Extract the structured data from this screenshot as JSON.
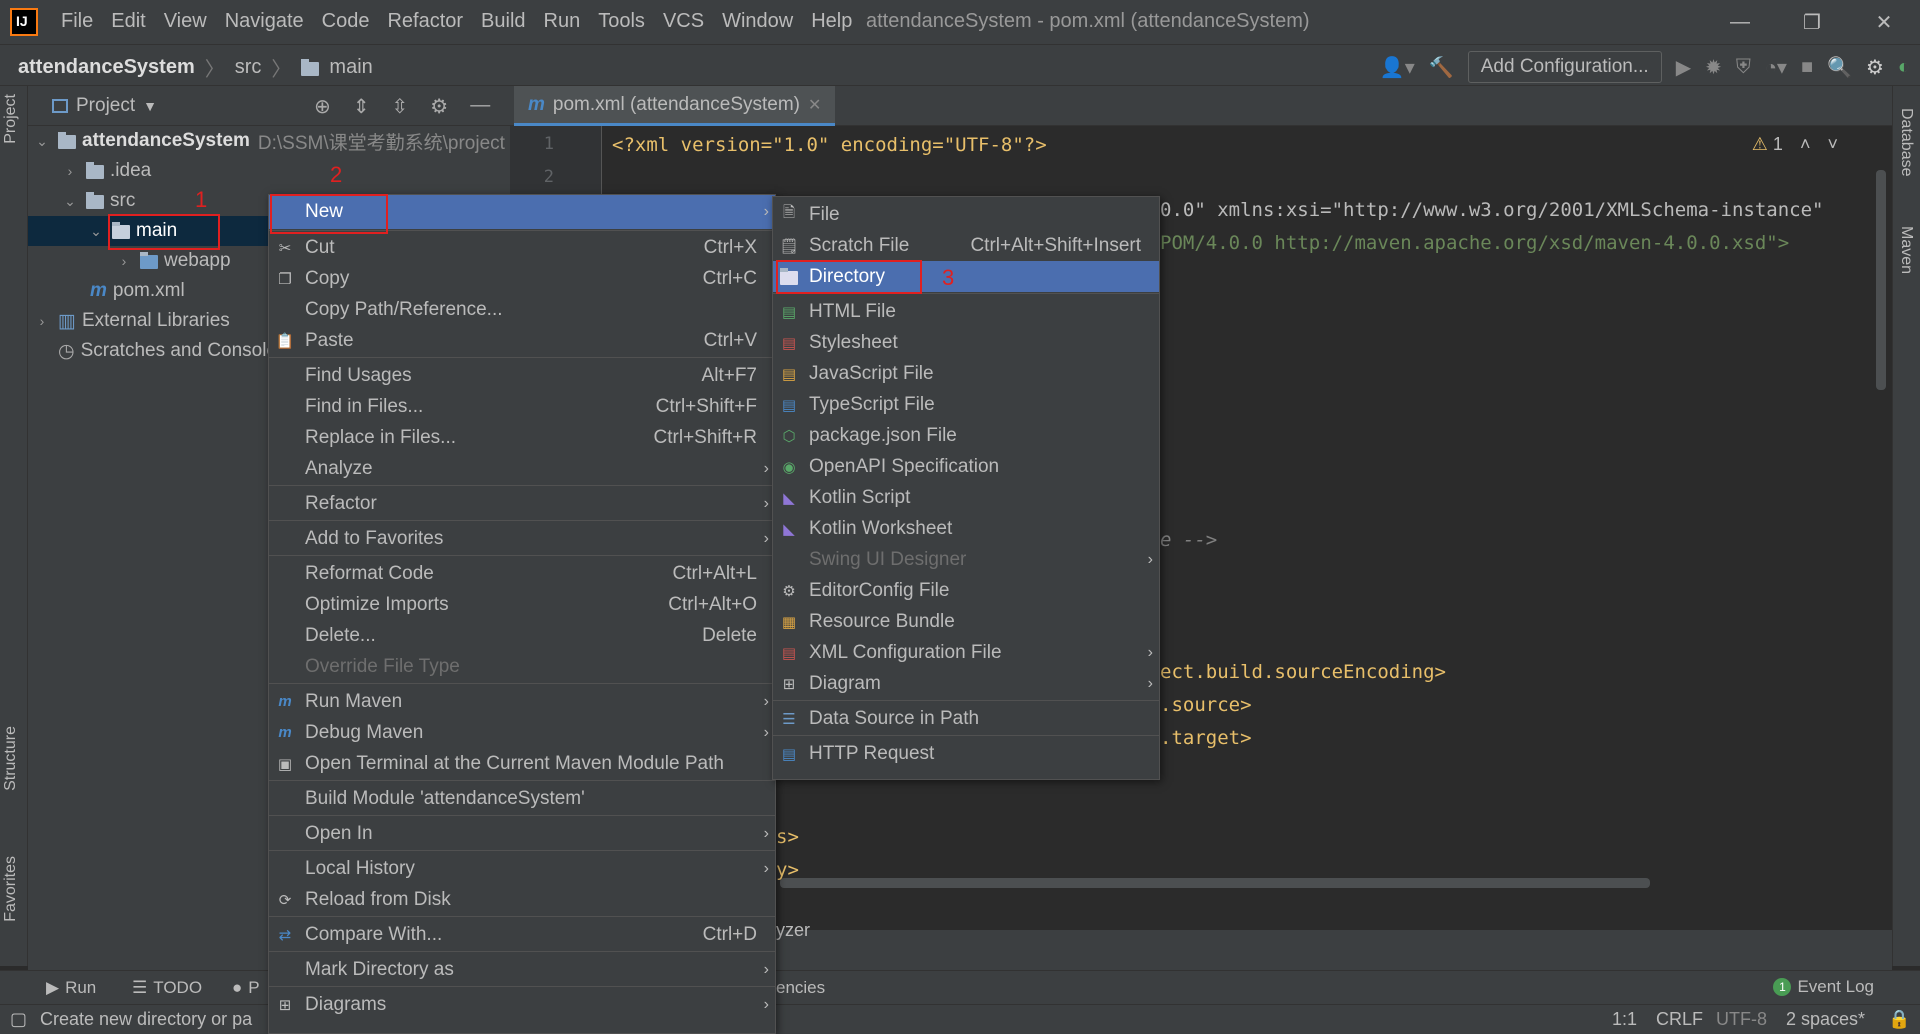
{
  "title_bar": {
    "menu": [
      "File",
      "Edit",
      "View",
      "Navigate",
      "Code",
      "Refactor",
      "Build",
      "Run",
      "Tools",
      "VCS",
      "Window",
      "Help"
    ],
    "window_title": "attendanceSystem - pom.xml (attendanceSystem)",
    "controls": [
      "—",
      "❐",
      "✕"
    ]
  },
  "nav_bar": {
    "breadcrumb": [
      "attendanceSystem",
      "src",
      "main"
    ],
    "add_config_label": "Add Configuration..."
  },
  "left_strip": {
    "project": "Project",
    "structure": "Structure",
    "favorites": "Favorites"
  },
  "right_strip": {
    "database": "Database",
    "maven": "Maven"
  },
  "project_panel": {
    "title": "Project",
    "tree": [
      {
        "label": "attendanceSystem",
        "path": "D:\\SSM\\课堂考勤系统\\project"
      },
      {
        "label": ".idea"
      },
      {
        "label": "src"
      },
      {
        "label": "main"
      },
      {
        "label": "webapp"
      },
      {
        "label": "pom.xml"
      },
      {
        "label": "External Libraries"
      },
      {
        "label": "Scratches and Console"
      }
    ]
  },
  "editor": {
    "tab_label": "pom.xml (attendanceSystem)",
    "line_numbers": [
      "1",
      "2"
    ],
    "warning_count": "1",
    "code": {
      "l1": "<?xml version=\"1.0\" encoding=\"UTF-8\"?>",
      "l3_tail": "0.0\" xmlns:xsi=\"http://www.w3.org/2001/XMLSchema-instance\"",
      "l4_tail": "POM/4.0.0 http://maven.apache.org/xsd/maven-4.0.0.xsd\">",
      "l15_tail": "e -->",
      "l19_tail": "ect.build.sourceEncoding>",
      "l20_tail": ".source>",
      "l21_tail": ".target>",
      "l25_tail": "s>",
      "l26_tail": "y>"
    }
  },
  "bottom_panel": {
    "tail1": "yzer",
    "tail2": "encies",
    "run": "Run",
    "todo": "TODO",
    "problems": "P",
    "event_log": "Event Log",
    "event_count": "1"
  },
  "status_bar": {
    "message": "Create new directory or pa",
    "position": "1:1",
    "line_sep": "CRLF",
    "encoding": "UTF-8",
    "indent": "2 spaces*"
  },
  "context_menu": {
    "items": [
      {
        "label": "New",
        "shortcut": "",
        "submenu": true
      },
      {
        "label": "Cut",
        "shortcut": "Ctrl+X"
      },
      {
        "label": "Copy",
        "shortcut": "Ctrl+C"
      },
      {
        "label": "Copy Path/Reference...",
        "shortcut": ""
      },
      {
        "label": "Paste",
        "shortcut": "Ctrl+V"
      },
      {
        "label": "Find Usages",
        "shortcut": "Alt+F7"
      },
      {
        "label": "Find in Files...",
        "shortcut": "Ctrl+Shift+F"
      },
      {
        "label": "Replace in Files...",
        "shortcut": "Ctrl+Shift+R"
      },
      {
        "label": "Analyze",
        "shortcut": "",
        "submenu": true
      },
      {
        "label": "Refactor",
        "shortcut": "",
        "submenu": true
      },
      {
        "label": "Add to Favorites",
        "shortcut": "",
        "submenu": true
      },
      {
        "label": "Reformat Code",
        "shortcut": "Ctrl+Alt+L"
      },
      {
        "label": "Optimize Imports",
        "shortcut": "Ctrl+Alt+O"
      },
      {
        "label": "Delete...",
        "shortcut": "Delete"
      },
      {
        "label": "Override File Type",
        "shortcut": ""
      },
      {
        "label": "Run Maven",
        "shortcut": "",
        "submenu": true
      },
      {
        "label": "Debug Maven",
        "shortcut": "",
        "submenu": true
      },
      {
        "label": "Open Terminal at the Current Maven Module Path",
        "shortcut": ""
      },
      {
        "label": "Build Module 'attendanceSystem'",
        "shortcut": ""
      },
      {
        "label": "Open In",
        "shortcut": "",
        "submenu": true
      },
      {
        "label": "Local History",
        "shortcut": "",
        "submenu": true
      },
      {
        "label": "Reload from Disk",
        "shortcut": ""
      },
      {
        "label": "Compare With...",
        "shortcut": "Ctrl+D"
      },
      {
        "label": "Mark Directory as",
        "shortcut": "",
        "submenu": true
      },
      {
        "label": "Diagrams",
        "shortcut": "",
        "submenu": true
      }
    ]
  },
  "new_submenu": {
    "items": [
      {
        "label": "File",
        "shortcut": ""
      },
      {
        "label": "Scratch File",
        "shortcut": "Ctrl+Alt+Shift+Insert"
      },
      {
        "label": "Directory",
        "shortcut": ""
      },
      {
        "label": "HTML File",
        "shortcut": ""
      },
      {
        "label": "Stylesheet",
        "shortcut": ""
      },
      {
        "label": "JavaScript File",
        "shortcut": ""
      },
      {
        "label": "TypeScript File",
        "shortcut": ""
      },
      {
        "label": "package.json File",
        "shortcut": ""
      },
      {
        "label": "OpenAPI Specification",
        "shortcut": ""
      },
      {
        "label": "Kotlin Script",
        "shortcut": ""
      },
      {
        "label": "Kotlin Worksheet",
        "shortcut": ""
      },
      {
        "label": "Swing UI Designer",
        "shortcut": ""
      },
      {
        "label": "EditorConfig File",
        "shortcut": ""
      },
      {
        "label": "Resource Bundle",
        "shortcut": ""
      },
      {
        "label": "XML Configuration File",
        "shortcut": ""
      },
      {
        "label": "Diagram",
        "shortcut": ""
      },
      {
        "label": "Data Source in Path",
        "shortcut": ""
      },
      {
        "label": "HTTP Request",
        "shortcut": ""
      }
    ]
  },
  "annotations": [
    "1",
    "2",
    "3"
  ],
  "colors": {
    "highlight": "#4b6eaf",
    "annotation": "#e02020",
    "selection": "#0d293e"
  }
}
